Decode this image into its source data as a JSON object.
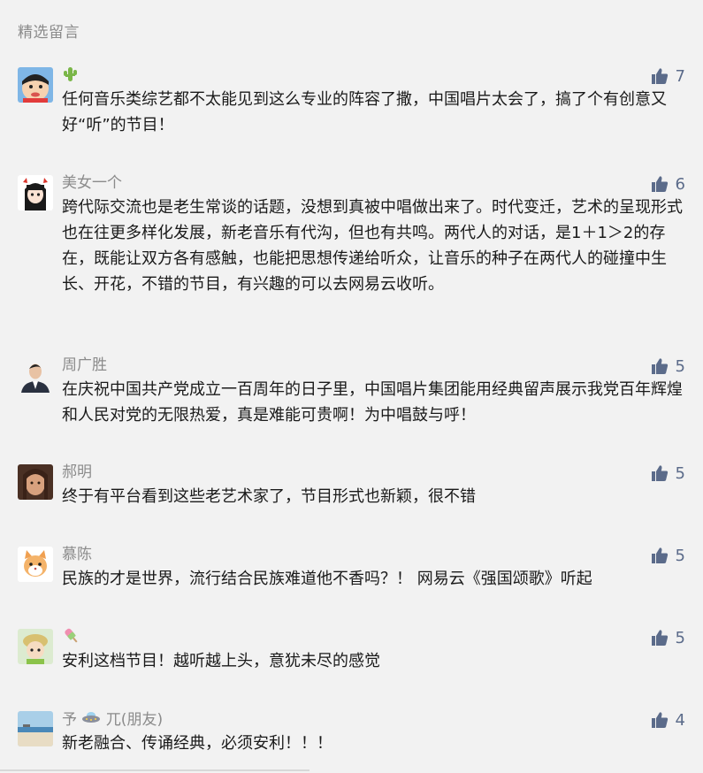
{
  "section": {
    "title": "精选留言"
  },
  "like_icon": "thumbs-up-icon",
  "colors": {
    "like": "#5b6b8a",
    "nickname": "#8b8b8b",
    "background": "#f2f2f2"
  },
  "comments": [
    {
      "nickname": "",
      "nickname_icon": "cactus-icon",
      "likes": "7",
      "text": "任何音乐类综艺都不太能见到这么专业的阵容了撒，中国唱片太会了，搞了个有创意又好“听”的节目！"
    },
    {
      "nickname": "美女一个",
      "likes": "6",
      "text": "跨代际交流也是老生常谈的话题，没想到真被中唱做出来了。时代变迁，艺术的呈现形式也在往更多样化发展，新老音乐有代沟，但也有共鸣。两代人的对话，是1＋1＞2的存在，既能让双方各有感触，也能把思想传递给听众，让音乐的种子在两代人的碰撞中生长、开花，不错的节目，有兴趣的可以去网易云收听。"
    },
    {
      "nickname": "周广胜",
      "likes": "5",
      "text": "在庆祝中国共产党成立一百周年的日子里，中国唱片集团能用经典留声展示我党百年辉煌和人民对党的无限热爱，真是难能可贵啊！为中唱鼓与呼！"
    },
    {
      "nickname": "郝明",
      "likes": "5",
      "text": "终于有平台看到这些老艺术家了，节目形式也新颖，很不错"
    },
    {
      "nickname": "慕陈",
      "likes": "5",
      "text": "民族的才是世界，流行结合民族难道他不香吗？！ 网易云《强国颂歌》听起"
    },
    {
      "nickname": "",
      "nickname_icon": "ice-pop-icon",
      "likes": "5",
      "text": "安利这档节目！越听越上头，意犹未尽的感觉"
    },
    {
      "nickname_prefix": "予",
      "nickname_icon": "ufo-icon",
      "nickname": "兀(朋友)",
      "likes": "4",
      "text": "新老融合、传诵经典，必须安利！！！"
    }
  ]
}
